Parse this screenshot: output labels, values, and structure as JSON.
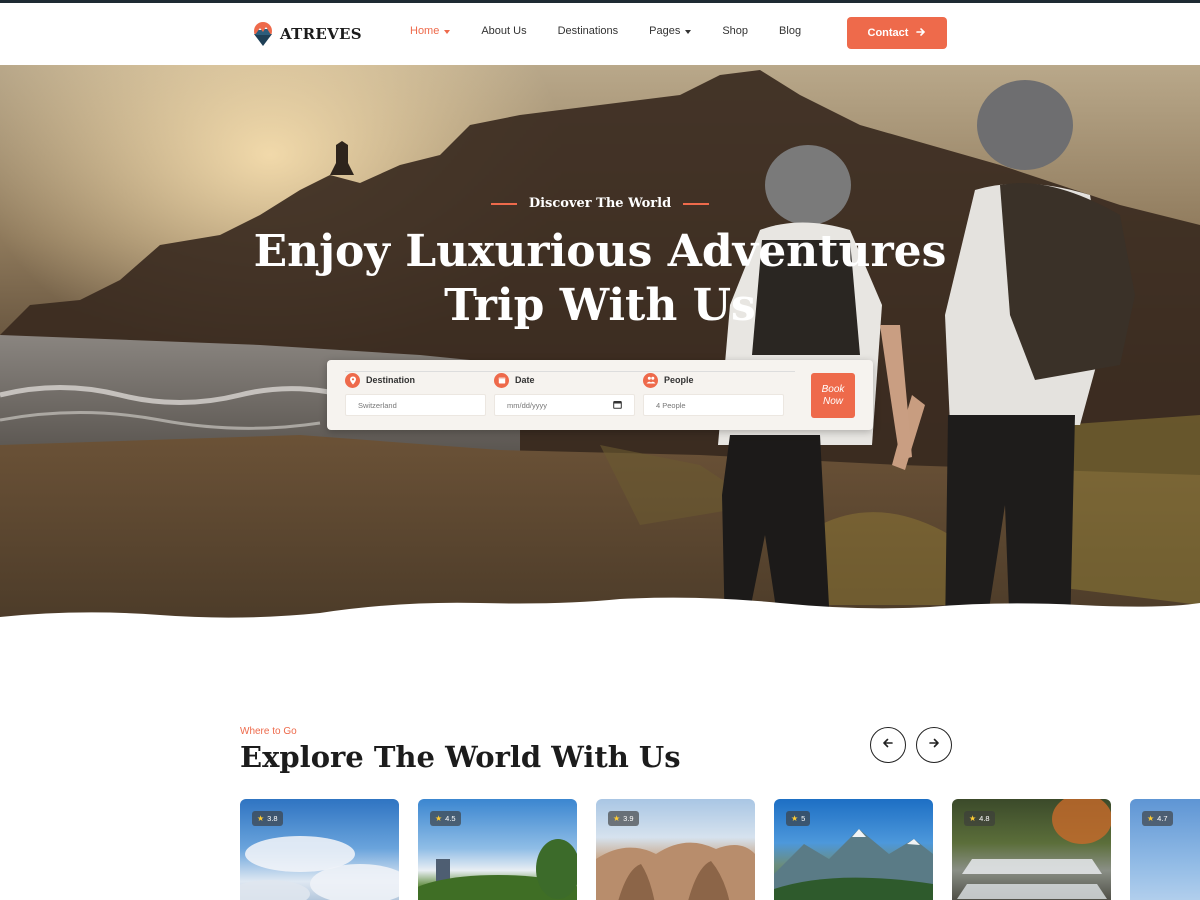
{
  "brand": {
    "name": "ATREVES"
  },
  "nav": [
    {
      "label": "Home",
      "has_dropdown": true,
      "active": true
    },
    {
      "label": "About Us",
      "has_dropdown": false,
      "active": false
    },
    {
      "label": "Destinations",
      "has_dropdown": false,
      "active": false
    },
    {
      "label": "Pages",
      "has_dropdown": true,
      "active": false
    },
    {
      "label": "Shop",
      "has_dropdown": false,
      "active": false
    },
    {
      "label": "Blog",
      "has_dropdown": false,
      "active": false
    }
  ],
  "header": {
    "contact_label": "Contact",
    "contact_icon": "arrow-right-icon"
  },
  "hero": {
    "kicker": "Discover The World",
    "title_line1": "Enjoy Luxurious Adventures",
    "title_line2": "Trip With Us"
  },
  "booking": {
    "destination": {
      "label": "Destination",
      "placeholder": "Switzerland",
      "icon": "map-pin-icon"
    },
    "date": {
      "label": "Date",
      "placeholder": "mm/dd/yyyy",
      "icon": "calendar-icon"
    },
    "people": {
      "label": "People",
      "placeholder": "4 People",
      "icon": "users-icon"
    },
    "button_label_1": "Book",
    "button_label_2": "Now"
  },
  "explore": {
    "kicker": "Where to Go",
    "title": "Explore The World With Us",
    "prev_icon": "arrow-left-icon",
    "next_icon": "arrow-right-icon"
  },
  "cards": [
    {
      "rating": "3.8"
    },
    {
      "rating": "4.5"
    },
    {
      "rating": "3.9"
    },
    {
      "rating": "5"
    },
    {
      "rating": "4.8"
    },
    {
      "rating": "4.7"
    }
  ],
  "colors": {
    "accent": "#ee6a4b",
    "dark": "#1c1c1c"
  }
}
